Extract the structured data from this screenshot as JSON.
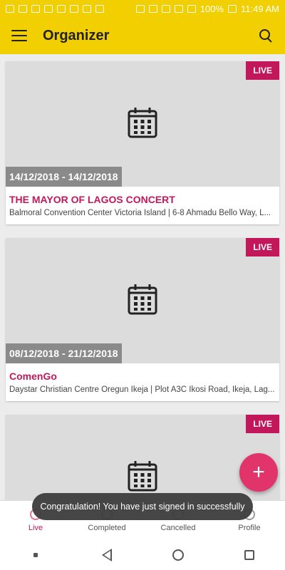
{
  "status_bar": {
    "left_icons": [
      "facebook-icon",
      "mail-icon",
      "translate-icon",
      "news-icon",
      "badge-21-icon",
      "missed-call-icon",
      "gmail-icon",
      "picture-icon",
      "dot-icon"
    ],
    "battery": "100%",
    "time": "11:49 AM",
    "right_icons": [
      "bluetooth-icon",
      "vibrate-icon",
      "nfc-icon",
      "alarm-icon",
      "wifi-icon",
      "signal-icon",
      "battery-icon"
    ]
  },
  "app_bar": {
    "title": "Organizer"
  },
  "cards": [
    {
      "badge": "LIVE",
      "date_range": "14/12/2018 - 14/12/2018",
      "title": "THE MAYOR OF LAGOS CONCERT",
      "location": "Balmoral Convention Center Victoria Island | 6-8 Ahmadu Bello Way, L..."
    },
    {
      "badge": "LIVE",
      "date_range": "08/12/2018 - 21/12/2018",
      "title": "ComenGo",
      "location": "Daystar Christian Centre Oregun Ikeja | Plot A3C Ikosi Road, Ikeja, Lag..."
    },
    {
      "badge": "LIVE"
    }
  ],
  "fab": {
    "label": "+"
  },
  "toast": {
    "message": "Congratulation! You have just signed in successfully"
  },
  "bottom_nav": [
    {
      "label": "Live",
      "active": true
    },
    {
      "label": "Completed",
      "active": false
    },
    {
      "label": "Cancelled",
      "active": false
    },
    {
      "label": "Profile",
      "active": false
    }
  ],
  "colors": {
    "app_bar": "#f2cf00",
    "accent": "#c2185b",
    "fab": "#e0346a",
    "date_badge": "#8a8a8a",
    "media_placeholder": "#dcdcdc"
  }
}
